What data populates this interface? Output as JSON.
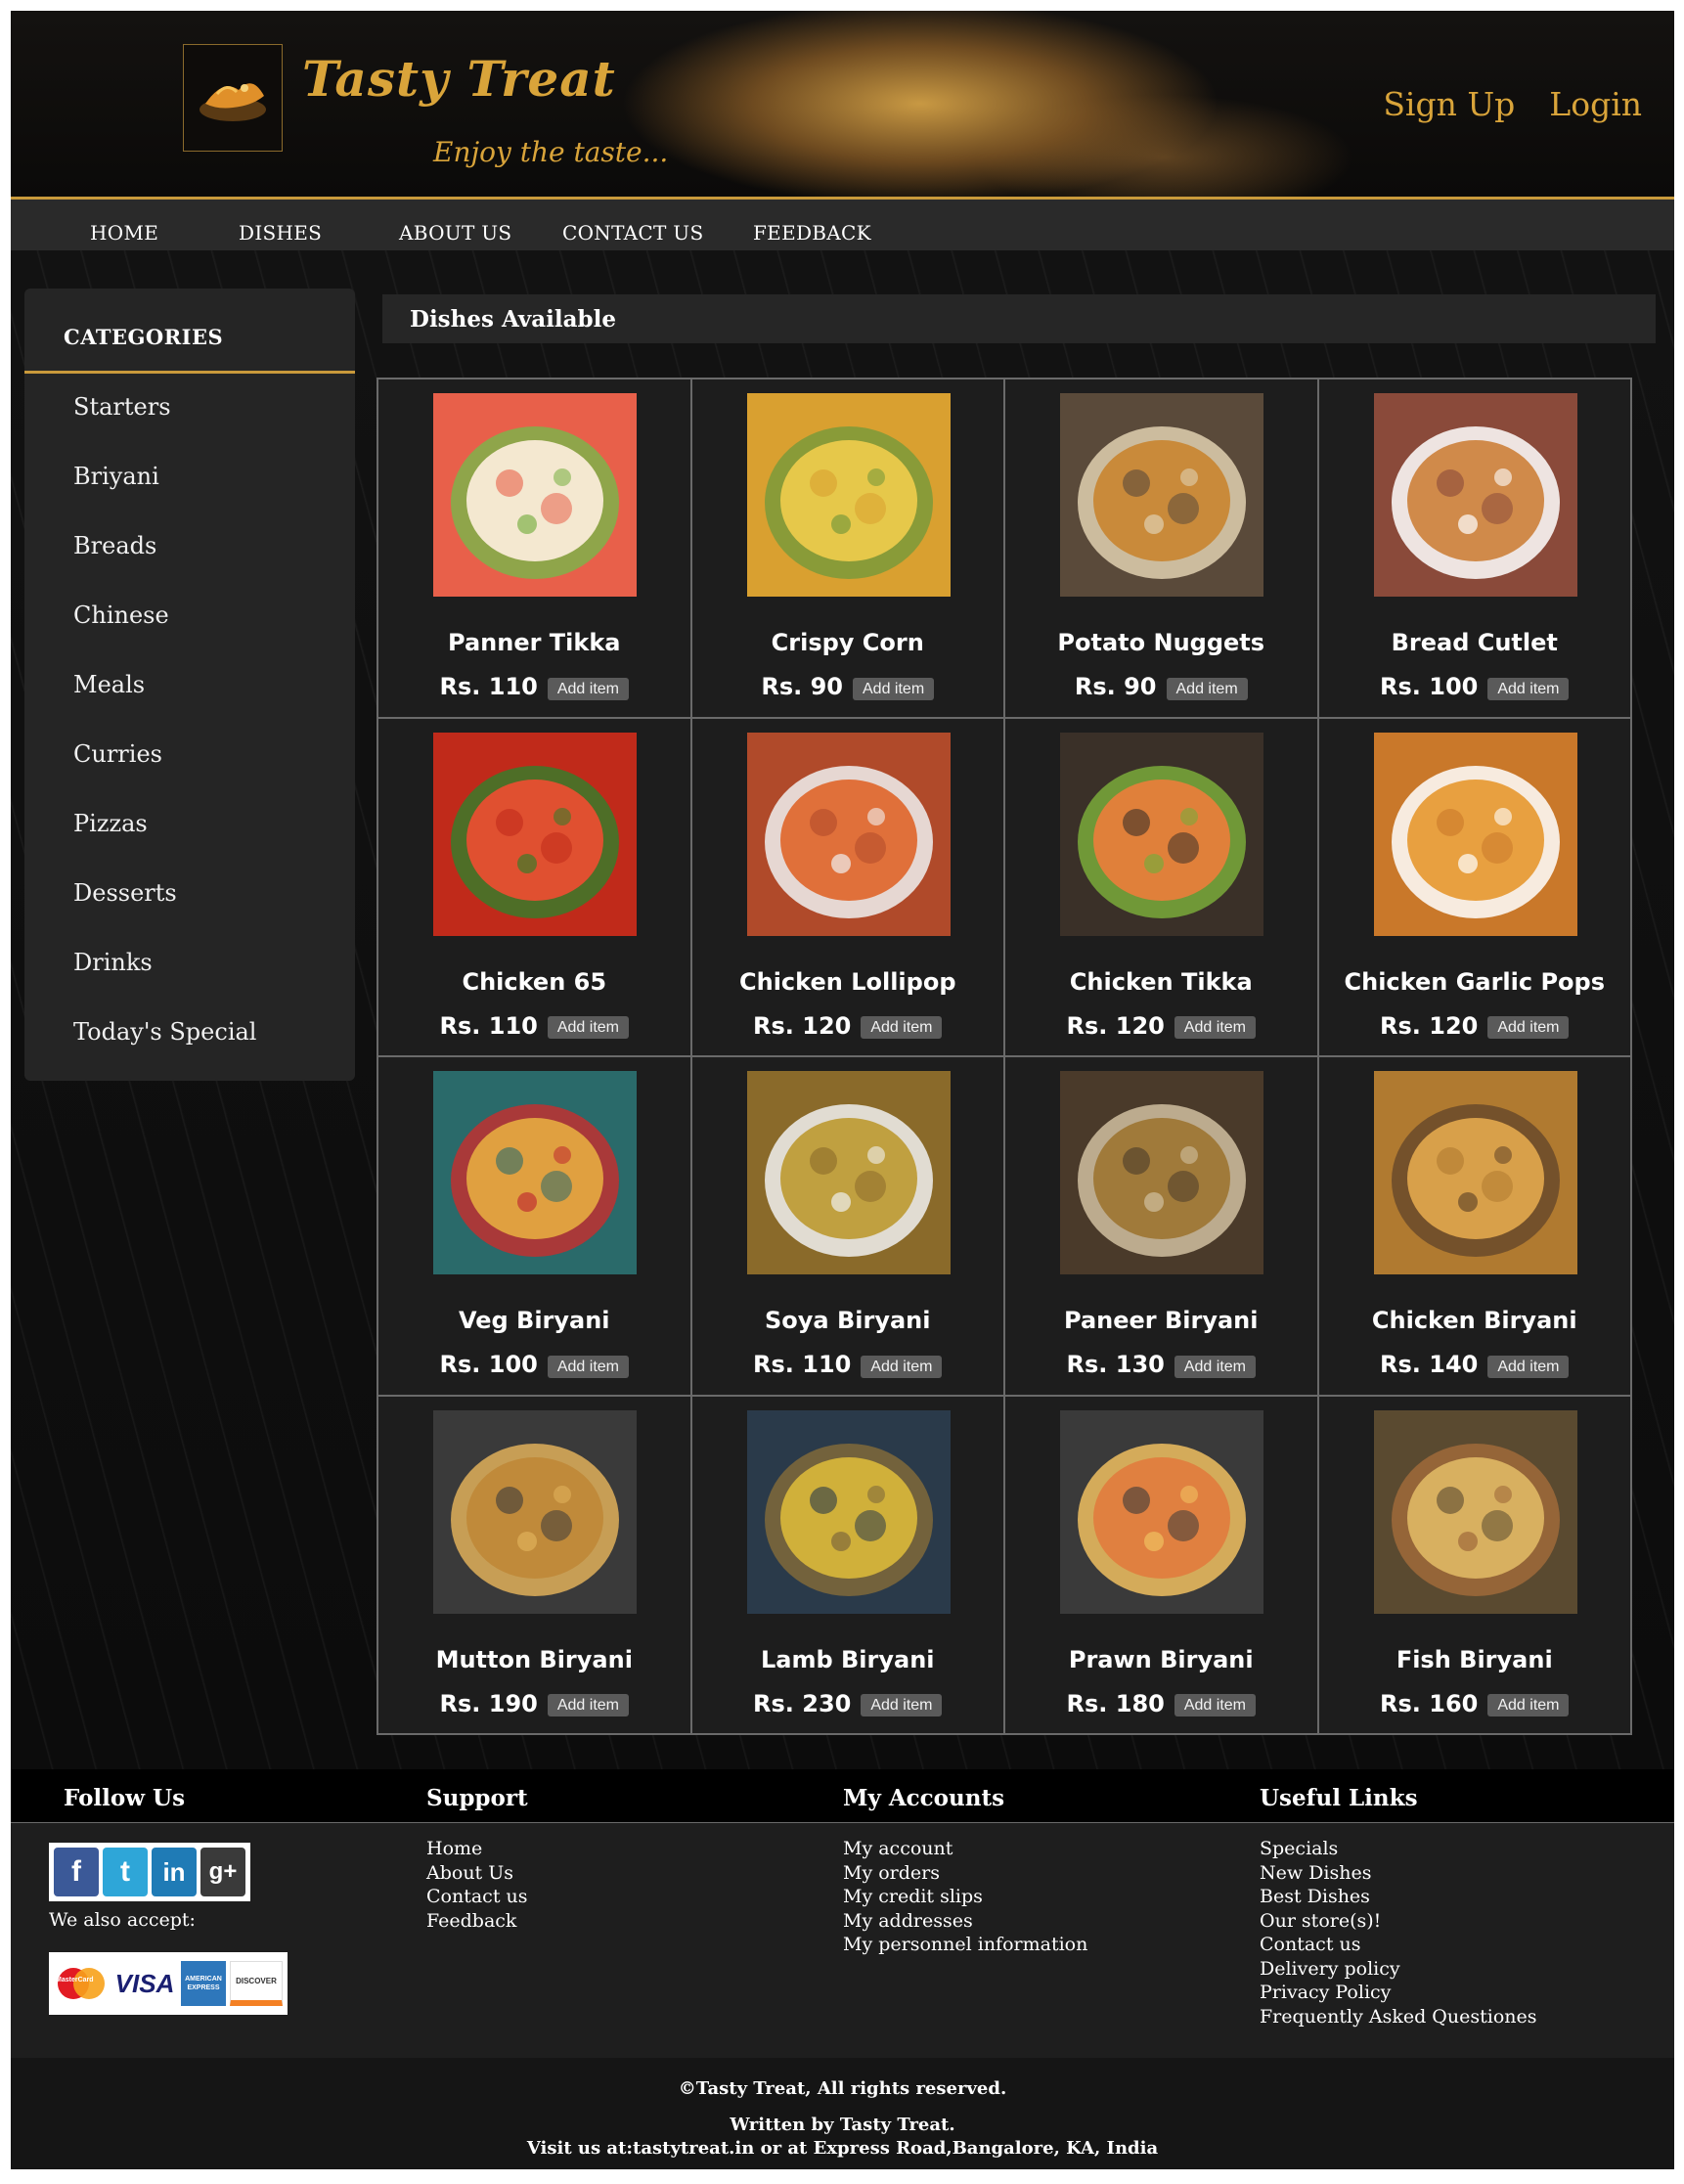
{
  "brand": {
    "name": "Tasty Treat",
    "tagline": "Enjoy the taste..."
  },
  "header": {
    "signup_label": "Sign Up",
    "login_label": "Login"
  },
  "nav": {
    "items": [
      "HOME",
      "DISHES",
      "ABOUT US",
      "CONTACT US",
      "FEEDBACK"
    ]
  },
  "sidebar": {
    "title": "CATEGORIES",
    "items": [
      "Starters",
      "Briyani",
      "Breads",
      "Chinese",
      "Meals",
      "Curries",
      "Pizzas",
      "Desserts",
      "Drinks",
      "Today's Special"
    ]
  },
  "main": {
    "title": "Dishes Available",
    "add_label": "Add item"
  },
  "dishes": [
    {
      "name": "Panner Tikka",
      "price": "Rs. 110",
      "icon": "paneer-tikka-image"
    },
    {
      "name": "Crispy Corn",
      "price": "Rs. 90",
      "icon": "crispy-corn-image"
    },
    {
      "name": "Potato Nuggets",
      "price": "Rs. 90",
      "icon": "potato-nuggets-image"
    },
    {
      "name": "Bread Cutlet",
      "price": "Rs. 100",
      "icon": "bread-cutlet-image"
    },
    {
      "name": "Chicken 65",
      "price": "Rs. 110",
      "icon": "chicken-65-image"
    },
    {
      "name": "Chicken Lollipop",
      "price": "Rs. 120",
      "icon": "chicken-lollipop-image"
    },
    {
      "name": "Chicken Tikka",
      "price": "Rs. 120",
      "icon": "chicken-tikka-image"
    },
    {
      "name": "Chicken Garlic Pops",
      "price": "Rs. 120",
      "icon": "chicken-garlic-pops-image"
    },
    {
      "name": "Veg Biryani",
      "price": "Rs. 100",
      "icon": "veg-biryani-image"
    },
    {
      "name": "Soya Biryani",
      "price": "Rs. 110",
      "icon": "soya-biryani-image"
    },
    {
      "name": "Paneer Biryani",
      "price": "Rs. 130",
      "icon": "paneer-biryani-image"
    },
    {
      "name": "Chicken Biryani",
      "price": "Rs. 140",
      "icon": "chicken-biryani-image"
    },
    {
      "name": "Mutton Biryani",
      "price": "Rs. 190",
      "icon": "mutton-biryani-image"
    },
    {
      "name": "Lamb Biryani",
      "price": "Rs. 230",
      "icon": "lamb-biryani-image"
    },
    {
      "name": "Prawn Biryani",
      "price": "Rs. 180",
      "icon": "prawn-biryani-image"
    },
    {
      "name": "Fish Biryani",
      "price": "Rs. 160",
      "icon": "fish-biryani-image"
    }
  ],
  "footer": {
    "follow": {
      "title": "Follow Us",
      "accept_text": "We also accept:",
      "social": [
        "f",
        "t",
        "in",
        "g+"
      ]
    },
    "payments": [
      "MasterCard",
      "VISA",
      "AMERICAN EXPRESS",
      "DISCOVER"
    ],
    "support": {
      "title": "Support",
      "links": [
        "Home",
        "About Us",
        "Contact us",
        "Feedback"
      ]
    },
    "accounts": {
      "title": "My Accounts",
      "links": [
        "My account",
        "My orders",
        "My credit slips",
        "My addresses",
        "My personnel information"
      ]
    },
    "useful": {
      "title": "Useful Links",
      "links": [
        "Specials",
        "New Dishes",
        "Best Dishes",
        "Our store(s)!",
        "Contact us",
        "Delivery policy",
        "Privacy Policy",
        "Frequently Asked Questiones"
      ]
    },
    "copyright": "©Tasty Treat, All rights reserved.",
    "written_by": "Written by Tasty Treat.",
    "visit": "Visit us at:tastytreat.in or at Express Road,Bangalore, KA, India"
  },
  "colors": {
    "accent": "#d9a43a",
    "background": "#1e1e1e",
    "nav": "#2a2a2a",
    "button": "#5a5a5a"
  }
}
